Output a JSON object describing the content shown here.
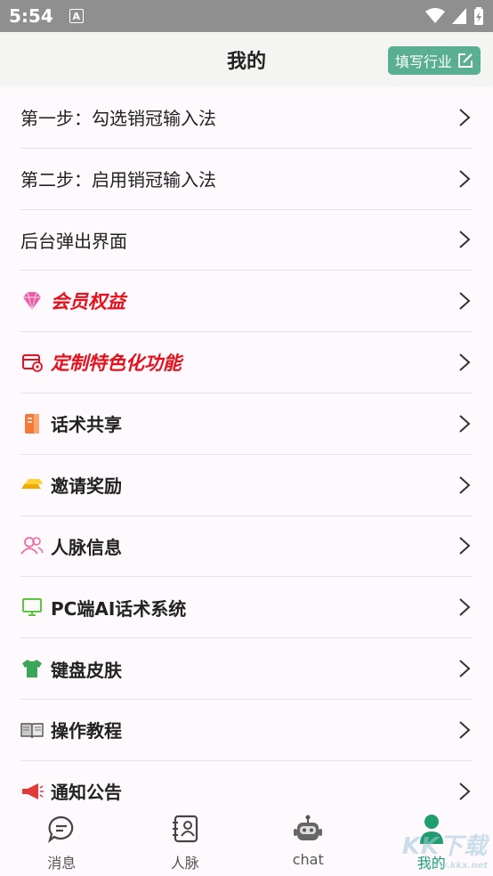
{
  "status_bar": {
    "time": "5:54",
    "notification_icon": "A"
  },
  "header": {
    "title": "我的",
    "fill_button_label": "填写行业"
  },
  "menu": [
    {
      "label": "第一步：勾选销冠输入法",
      "icon": "",
      "style": "plain"
    },
    {
      "label": "第二步：启用销冠输入法",
      "icon": "",
      "style": "plain"
    },
    {
      "label": "后台弹出界面",
      "icon": "",
      "style": "plain"
    },
    {
      "label": "会员权益",
      "icon": "diamond-icon",
      "style": "vip"
    },
    {
      "label": "定制特色化功能",
      "icon": "custom-card-icon",
      "style": "vip"
    },
    {
      "label": "话术共享",
      "icon": "notebook-icon",
      "style": "bold"
    },
    {
      "label": "邀请奖励",
      "icon": "gold-bar-icon",
      "style": "bold"
    },
    {
      "label": "人脉信息",
      "icon": "people-icon",
      "style": "bold"
    },
    {
      "label": "PC端AI话术系统",
      "icon": "monitor-icon",
      "style": "bold"
    },
    {
      "label": "键盘皮肤",
      "icon": "tshirt-icon",
      "style": "bold"
    },
    {
      "label": "操作教程",
      "icon": "book-icon",
      "style": "bold"
    },
    {
      "label": "通知公告",
      "icon": "megaphone-icon",
      "style": "bold"
    }
  ],
  "tabs": [
    {
      "label": "消息",
      "icon": "message-icon"
    },
    {
      "label": "人脉",
      "icon": "contacts-icon"
    },
    {
      "label": "chat",
      "icon": "robot-icon"
    },
    {
      "label": "我的",
      "icon": "profile-icon",
      "active": true
    }
  ],
  "watermark": {
    "text": "KK下载",
    "sub": "www.kkx.net"
  },
  "colors": {
    "accent": "#5aaf93",
    "vip_red": "#e8101c",
    "active_tab": "#1e9e6e"
  }
}
